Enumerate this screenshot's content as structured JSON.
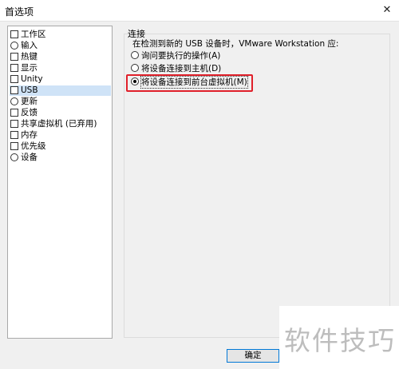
{
  "window": {
    "title": "首选项",
    "close_glyph": "✕"
  },
  "nav": {
    "items": [
      {
        "label": "工作区",
        "icon": "workspace-icon"
      },
      {
        "label": "输入",
        "icon": "input-icon"
      },
      {
        "label": "热键",
        "icon": "hotkey-icon"
      },
      {
        "label": "显示",
        "icon": "display-icon"
      },
      {
        "label": "Unity",
        "icon": "unity-icon"
      },
      {
        "label": "USB",
        "icon": "usb-icon",
        "selected": true
      },
      {
        "label": "更新",
        "icon": "update-icon"
      },
      {
        "label": "反馈",
        "icon": "feedback-icon"
      },
      {
        "label": "共享虚拟机 (已弃用)",
        "icon": "shared-vm-icon"
      },
      {
        "label": "内存",
        "icon": "memory-icon"
      },
      {
        "label": "优先级",
        "icon": "priority-icon"
      },
      {
        "label": "设备",
        "icon": "devices-icon"
      }
    ]
  },
  "connection": {
    "group_title": "连接",
    "description": "在检测到新的 USB 设备时，VMware Workstation 应:",
    "options": [
      {
        "label": "询问要执行的操作(A)",
        "selected": false
      },
      {
        "label": "将设备连接到主机(D)",
        "selected": false
      },
      {
        "label": "将设备连接到前台虚拟机(M)",
        "selected": true
      }
    ]
  },
  "footer": {
    "ok_label": "确定"
  },
  "watermark": {
    "text": "软件技巧"
  },
  "colors": {
    "highlight": "#e0202a",
    "selection": "#cfe3f7",
    "button_border": "#0078d7"
  }
}
